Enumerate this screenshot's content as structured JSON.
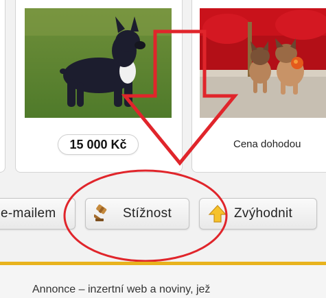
{
  "listings": [
    {
      "price": "15 000 Kč",
      "image": "black french bulldog on grass"
    },
    {
      "price": "Cena dohodou",
      "image": "two fawn french bulldog puppies by red sofa"
    }
  ],
  "actions": {
    "email_label": "e-mailem",
    "complaint_label": "Stížnost",
    "promote_label": "Zvýhodnit"
  },
  "footer": {
    "text": "Annonce – inzertní web a noviny, jež"
  },
  "colors": {
    "accent": "#e8b31e",
    "annotation_red": "#e0252b"
  },
  "icons": [
    "gavel-icon",
    "arrow-up-icon"
  ]
}
